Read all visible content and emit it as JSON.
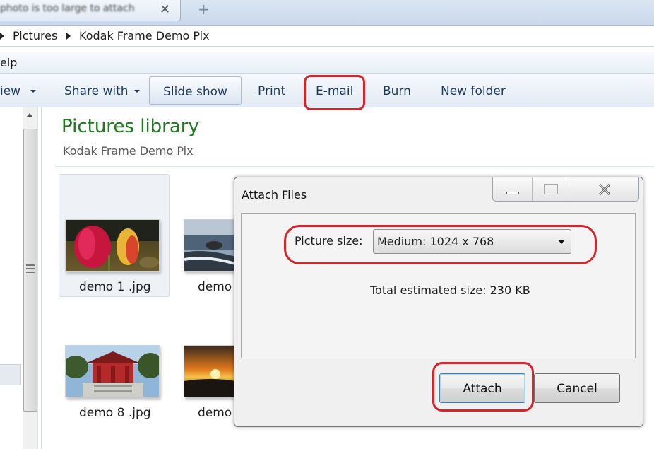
{
  "browser": {
    "tab_title": "photo is too large to attach",
    "tab_close": "✕",
    "new_tab": "+"
  },
  "address_bar": {
    "crumbs": [
      "Pictures",
      "Kodak Frame Demo Pix"
    ]
  },
  "menu_bar": {
    "help": "elp"
  },
  "toolbar": {
    "view": "iew",
    "share_with": "Share with",
    "slide_show": "Slide show",
    "print": "Print",
    "email": "E-mail",
    "burn": "Burn",
    "new_folder": "New folder"
  },
  "library": {
    "title": "Pictures library",
    "subtitle": "Kodak Frame Demo Pix"
  },
  "files": [
    {
      "name": "demo 1 .jpg"
    },
    {
      "name": "demo"
    },
    {
      "name": "demo 8 .jpg"
    },
    {
      "name": "demo"
    }
  ],
  "dialog": {
    "title": "Attach Files",
    "picture_size_label": "Picture size:",
    "picture_size_value": "Medium: 1024 x 768",
    "estimated_size": "Total estimated size:  230 KB",
    "attach_label": "Attach",
    "cancel_label": "Cancel"
  },
  "colors": {
    "annotation_red": "#d8232a",
    "library_title_green": "#1e7a1e",
    "toolbar_text": "#1e395b"
  }
}
